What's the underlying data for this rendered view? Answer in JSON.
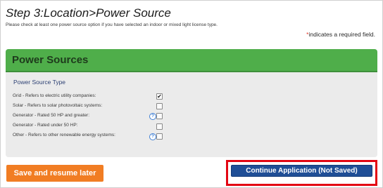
{
  "page": {
    "title": "Step 3:Location>Power Source",
    "instructions": "Please check at least one power source option if you have selected an indoor or mixed light license type.",
    "required_star": "*",
    "required_note": "indicates a required field."
  },
  "panel": {
    "title": "Power Sources",
    "section_label": "Power Source Type",
    "options": [
      {
        "label": "Grid - Refers to electric utility companies:",
        "checked": true,
        "help": false
      },
      {
        "label": "Solar - Refers to solar photovoltaic systems:",
        "checked": false,
        "help": false
      },
      {
        "label": "Generator - Rated 50 HP and greater:",
        "checked": false,
        "help": true
      },
      {
        "label": "Generator - Rated under 50 HP:",
        "checked": false,
        "help": false
      },
      {
        "label": "Other - Refers to other renewable energy systems:",
        "checked": false,
        "help": true
      }
    ],
    "check_mark": "✔",
    "help_glyph": "?"
  },
  "buttons": {
    "save_label": "Save and resume later",
    "continue_label": "Continue Application (Not Saved)"
  },
  "colors": {
    "header_green": "#4fae4a",
    "save_orange": "#f17d23",
    "continue_blue": "#1f4e96",
    "highlight_red": "#e30613",
    "required_red": "#e23a2c"
  }
}
